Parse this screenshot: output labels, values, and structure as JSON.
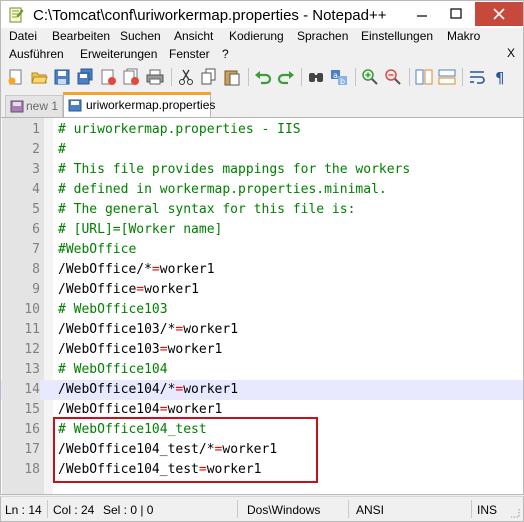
{
  "window": {
    "title": "C:\\Tomcat\\conf\\uriworkermap.properties - Notepad++",
    "close_color": "#c7493b"
  },
  "menu": {
    "row1": [
      "Datei",
      "Bearbeiten",
      "Suchen",
      "Ansicht",
      "Kodierung",
      "Sprachen",
      "Einstellungen",
      "Makro"
    ],
    "row2": [
      "Ausführen",
      "Erweiterungen",
      "Fenster",
      "?"
    ],
    "close_doc": "X"
  },
  "toolbar": {
    "icons": [
      "new-file-icon",
      "open-file-icon",
      "save-icon",
      "save-all-icon",
      "close-icon",
      "close-all-icon",
      "print-icon",
      "cut-icon",
      "copy-icon",
      "paste-icon",
      "undo-icon",
      "redo-icon",
      "find-icon",
      "replace-icon",
      "zoom-in-icon",
      "zoom-out-icon",
      "sync-vertical-icon",
      "sync-horizontal-icon",
      "word-wrap-icon",
      "show-all-chars-icon"
    ]
  },
  "tabs": [
    {
      "label": "new 1",
      "active": false
    },
    {
      "label": "uriworkermap.properties",
      "active": true
    }
  ],
  "editor": {
    "current_line": 14,
    "lines": [
      {
        "n": "1",
        "text": "# uriworkermap.properties - IIS",
        "kind": "comment"
      },
      {
        "n": "2",
        "text": "#",
        "kind": "comment"
      },
      {
        "n": "3",
        "text": "# This file provides mappings for the workers",
        "kind": "comment"
      },
      {
        "n": "4",
        "text": "# defined in workermap.properties.minimal.",
        "kind": "comment"
      },
      {
        "n": "5",
        "text": "# The general syntax for this file is:",
        "kind": "comment"
      },
      {
        "n": "6",
        "text": "# [URL]=[Worker name]",
        "kind": "comment"
      },
      {
        "n": "7",
        "text": "#WebOffice",
        "kind": "comment"
      },
      {
        "n": "8",
        "key": "/WebOffice/*",
        "value": "worker1",
        "kind": "pair"
      },
      {
        "n": "9",
        "key": "/WebOffice",
        "value": "worker1",
        "kind": "pair"
      },
      {
        "n": "10",
        "text": "# WebOffice103",
        "kind": "comment"
      },
      {
        "n": "11",
        "key": "/WebOffice103/*",
        "value": "worker1",
        "kind": "pair"
      },
      {
        "n": "12",
        "key": "/WebOffice103",
        "value": "worker1",
        "kind": "pair"
      },
      {
        "n": "13",
        "text": "# WebOffice104",
        "kind": "comment"
      },
      {
        "n": "14",
        "key": "/WebOffice104/*",
        "value": "worker1",
        "kind": "pair"
      },
      {
        "n": "15",
        "key": "/WebOffice104",
        "value": "worker1",
        "kind": "pair"
      },
      {
        "n": "16",
        "text": "# WebOffice104_test",
        "kind": "comment"
      },
      {
        "n": "17",
        "key": "/WebOffice104_test/*",
        "value": "worker1",
        "kind": "pair"
      },
      {
        "n": "18",
        "key": "/WebOffice104_test",
        "value": "worker1",
        "kind": "pair"
      }
    ],
    "equals": "=",
    "colors": {
      "comment": "#008000",
      "operator": "#ff0000",
      "highlight": "#c8101a",
      "current_line": "#e8e8ff"
    }
  },
  "status": {
    "ln": "Ln : 14",
    "col": "Col : 24",
    "sel": "Sel : 0 | 0",
    "eol": "Dos\\Windows",
    "encoding": "ANSI",
    "mode": "INS"
  }
}
